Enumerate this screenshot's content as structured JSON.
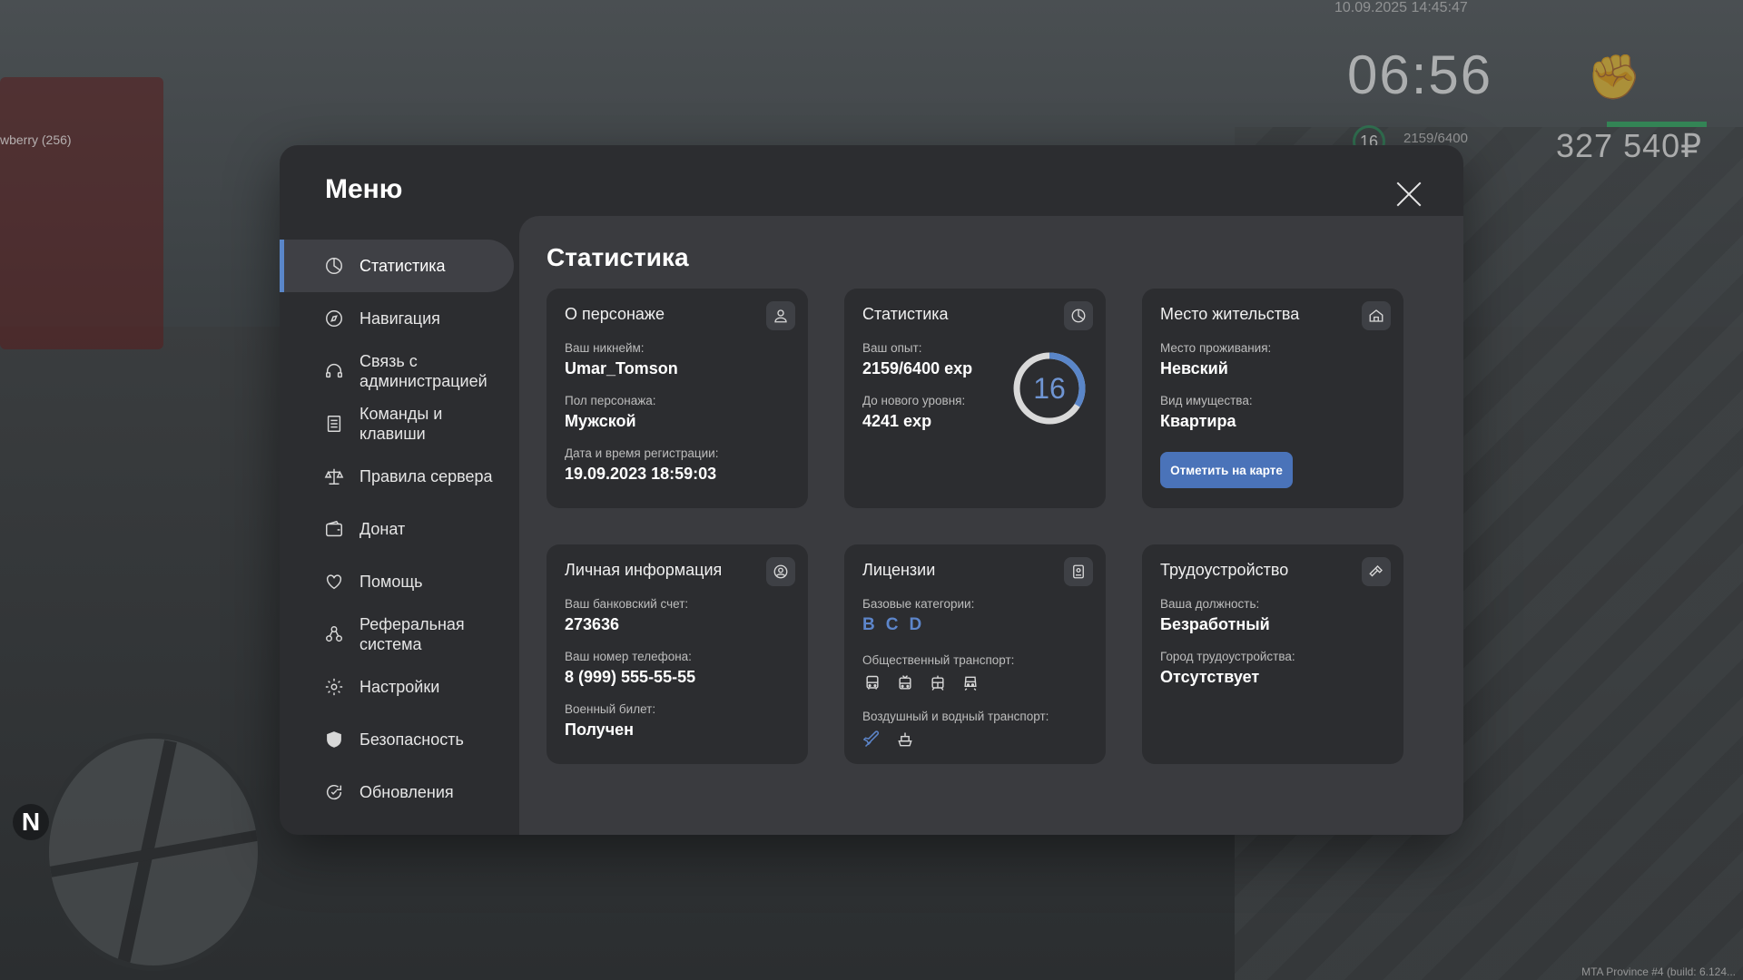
{
  "hud": {
    "datetime": "10.09.2025 14:45:47",
    "time": "06:56",
    "level": "16",
    "exp": "2159/6400",
    "money": "327 540₽",
    "player_tag": "wberry (256)",
    "north": "N",
    "version": "MTA Province #4 (build: 6.124..."
  },
  "modal": {
    "title": "Меню",
    "sidebar": [
      {
        "label": "Статистика",
        "icon": "pie-chart-icon",
        "active": true
      },
      {
        "label": "Навигация",
        "icon": "compass-icon"
      },
      {
        "label": "Связь с администрацией",
        "icon": "headset-icon"
      },
      {
        "label": "Команды и клавиши",
        "icon": "document-list-icon"
      },
      {
        "label": "Правила сервера",
        "icon": "scales-icon"
      },
      {
        "label": "Донат",
        "icon": "wallet-icon"
      },
      {
        "label": "Помощь",
        "icon": "heart-hands-icon"
      },
      {
        "label": "Реферальная система",
        "icon": "referral-network-icon"
      },
      {
        "label": "Настройки",
        "icon": "gear-icon"
      },
      {
        "label": "Безопасность",
        "icon": "shield-icon"
      },
      {
        "label": "Обновления",
        "icon": "refresh-check-icon"
      }
    ],
    "content_title": "Статистика",
    "cards": {
      "character": {
        "title": "О персонаже",
        "nickname_label": "Ваш никнейм:",
        "nickname": "Umar_Tomson",
        "gender_label": "Пол персонажа:",
        "gender": "Мужской",
        "reg_label": "Дата и время регистрации:",
        "reg": "19.09.2023 18:59:03"
      },
      "stats": {
        "title": "Статистика",
        "exp_label": "Ваш опыт:",
        "exp": "2159/6400 exp",
        "next_label": "До нового уровня:",
        "next": "4241 exp",
        "level": "16",
        "progress": 0.337
      },
      "residence": {
        "title": "Место жительства",
        "place_label": "Место проживания:",
        "place": "Невский",
        "property_label": "Вид имущества:",
        "property": "Квартира",
        "button": "Отметить на карте"
      },
      "personal": {
        "title": "Личная информация",
        "bank_label": "Ваш банковский счет:",
        "bank": "273636",
        "phone_label": "Ваш номер телефона:",
        "phone": "8 (999) 555-55-55",
        "military_label": "Военный билет:",
        "military": "Получен"
      },
      "licenses": {
        "title": "Лицензии",
        "base_label": "Базовые категории:",
        "base": [
          "B",
          "C",
          "D"
        ],
        "public_label": "Общественный транспорт:",
        "public_icons": [
          "bus-icon",
          "trolleybus-icon",
          "tram-icon",
          "train-icon"
        ],
        "air_label": "Воздушный и водный транспорт:",
        "air_icons": [
          "plane-icon",
          "boat-icon"
        ]
      },
      "job": {
        "title": "Трудоустройство",
        "position_label": "Ваша должность:",
        "position": "Безработный",
        "city_label": "Город трудоустройства:",
        "city": "Отсутствует"
      }
    }
  },
  "colors": {
    "accent": "#5a86c9",
    "button": "#4a73b9",
    "panel": "#2c2d30",
    "content": "#3a3b3f"
  }
}
